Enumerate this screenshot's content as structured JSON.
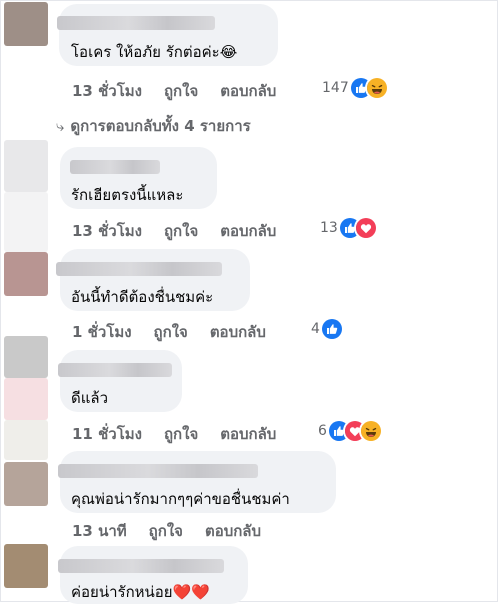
{
  "comments": [
    {
      "text": "โอเคร ให้อภัย รักต่อค่ะ😂",
      "time": "13 ชั่วโมง",
      "reaction_count": "147",
      "reactions": [
        "like",
        "haha"
      ]
    },
    {
      "text": "รักเฮียตรงนี้แหละ",
      "time": "13 ชั่วโมง",
      "reaction_count": "13",
      "reactions": [
        "like",
        "love"
      ]
    },
    {
      "text": "อันนี้ทำดีต้องชื่นชมค่ะ",
      "time": "1 ชั่วโมง",
      "reaction_count": "4",
      "reactions": [
        "like"
      ]
    },
    {
      "text": "ดีแล้ว",
      "time": "11 ชั่วโมง",
      "reaction_count": "6",
      "reactions": [
        "like",
        "love",
        "haha"
      ]
    },
    {
      "text": "คุณพ่อน่ารักมากๆๆค่าขอชื่นชมค่า",
      "time": "13 นาที",
      "reaction_count": "",
      "reactions": []
    },
    {
      "text": "ค่อยน่ารักหน่อย❤️❤️",
      "time": "",
      "reaction_count": "",
      "reactions": []
    }
  ],
  "actions": {
    "like": "ถูกใจ",
    "reply": "ตอบกลับ"
  },
  "view_replies": "ดูการตอบกลับทั้ง 4 รายการ",
  "colors": {
    "bubble": "#f0f2f5",
    "meta_text": "#65676b",
    "like_blue": "#1877f2",
    "love_red": "#f33e58",
    "haha_yellow": "#f7b125"
  },
  "icons": {
    "like": "thumbs-up-icon",
    "love": "heart-icon",
    "haha": "laughing-face-icon",
    "reply_arrow": "reply-arrow-icon"
  }
}
